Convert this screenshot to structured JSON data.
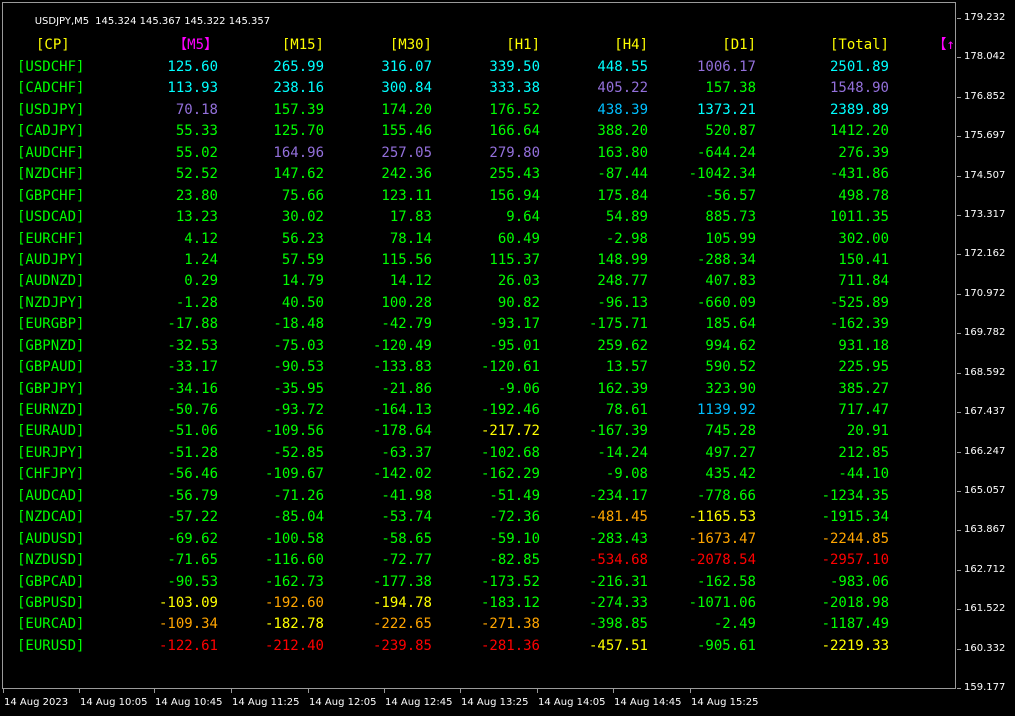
{
  "header": {
    "symbol": "USDJPY,M5",
    "quote": "145.324 145.367 145.322 145.357"
  },
  "colors": {
    "header": "#ffff00",
    "header_accent": "#ff00ff",
    "pair_label": "#00ff00",
    "green": "#00ff00",
    "light_green": "#7cfc00",
    "cyan": "#00ffff",
    "purple": "#9370db",
    "sky": "#00bfff",
    "yellow": "#ffff00",
    "orange": "#ffa500",
    "red": "#ff0000"
  },
  "table": {
    "columns": [
      {
        "label": "[CP]",
        "color": "header"
      },
      {
        "label": "【M5】",
        "color": "header_accent"
      },
      {
        "label": "[M15]",
        "color": "header"
      },
      {
        "label": "[M30]",
        "color": "header"
      },
      {
        "label": "[H1]",
        "color": "header"
      },
      {
        "label": "[H4]",
        "color": "header"
      },
      {
        "label": "[D1]",
        "color": "header"
      },
      {
        "label": "[Total]",
        "color": "header"
      },
      {
        "label": "【↑",
        "color": "header_accent"
      }
    ],
    "rows": [
      {
        "pair": "[USDCHF]",
        "cells": [
          [
            "125.60",
            "cyan"
          ],
          [
            "265.99",
            "cyan"
          ],
          [
            "316.07",
            "cyan"
          ],
          [
            "339.50",
            "cyan"
          ],
          [
            "448.55",
            "cyan"
          ],
          [
            "1006.17",
            "purple"
          ],
          [
            "2501.89",
            "cyan"
          ]
        ]
      },
      {
        "pair": "[CADCHF]",
        "cells": [
          [
            "113.93",
            "cyan"
          ],
          [
            "238.16",
            "cyan"
          ],
          [
            "300.84",
            "cyan"
          ],
          [
            "333.38",
            "cyan"
          ],
          [
            "405.22",
            "purple"
          ],
          [
            "157.38",
            "green"
          ],
          [
            "1548.90",
            "purple"
          ]
        ]
      },
      {
        "pair": "[USDJPY]",
        "cells": [
          [
            "70.18",
            "purple"
          ],
          [
            "157.39",
            "green"
          ],
          [
            "174.20",
            "green"
          ],
          [
            "176.52",
            "green"
          ],
          [
            "438.39",
            "sky"
          ],
          [
            "1373.21",
            "cyan"
          ],
          [
            "2389.89",
            "cyan"
          ]
        ]
      },
      {
        "pair": "[CADJPY]",
        "cells": [
          [
            "55.33",
            "green"
          ],
          [
            "125.70",
            "green"
          ],
          [
            "155.46",
            "green"
          ],
          [
            "166.64",
            "green"
          ],
          [
            "388.20",
            "green"
          ],
          [
            "520.87",
            "green"
          ],
          [
            "1412.20",
            "green"
          ]
        ]
      },
      {
        "pair": "[AUDCHF]",
        "cells": [
          [
            "55.02",
            "green"
          ],
          [
            "164.96",
            "purple"
          ],
          [
            "257.05",
            "purple"
          ],
          [
            "279.80",
            "purple"
          ],
          [
            "163.80",
            "green"
          ],
          [
            "-644.24",
            "green"
          ],
          [
            "276.39",
            "green"
          ]
        ]
      },
      {
        "pair": "[NZDCHF]",
        "cells": [
          [
            "52.52",
            "green"
          ],
          [
            "147.62",
            "green"
          ],
          [
            "242.36",
            "green"
          ],
          [
            "255.43",
            "green"
          ],
          [
            "-87.44",
            "green"
          ],
          [
            "-1042.34",
            "green"
          ],
          [
            "-431.86",
            "green"
          ]
        ]
      },
      {
        "pair": "[GBPCHF]",
        "cells": [
          [
            "23.80",
            "green"
          ],
          [
            "75.66",
            "green"
          ],
          [
            "123.11",
            "green"
          ],
          [
            "156.94",
            "green"
          ],
          [
            "175.84",
            "green"
          ],
          [
            "-56.57",
            "green"
          ],
          [
            "498.78",
            "green"
          ]
        ]
      },
      {
        "pair": "[USDCAD]",
        "cells": [
          [
            "13.23",
            "green"
          ],
          [
            "30.02",
            "green"
          ],
          [
            "17.83",
            "green"
          ],
          [
            "9.64",
            "green"
          ],
          [
            "54.89",
            "green"
          ],
          [
            "885.73",
            "green"
          ],
          [
            "1011.35",
            "green"
          ]
        ]
      },
      {
        "pair": "[EURCHF]",
        "cells": [
          [
            "4.12",
            "green"
          ],
          [
            "56.23",
            "green"
          ],
          [
            "78.14",
            "green"
          ],
          [
            "60.49",
            "green"
          ],
          [
            "-2.98",
            "green"
          ],
          [
            "105.99",
            "green"
          ],
          [
            "302.00",
            "green"
          ]
        ]
      },
      {
        "pair": "[AUDJPY]",
        "cells": [
          [
            "1.24",
            "green"
          ],
          [
            "57.59",
            "green"
          ],
          [
            "115.56",
            "green"
          ],
          [
            "115.37",
            "green"
          ],
          [
            "148.99",
            "green"
          ],
          [
            "-288.34",
            "green"
          ],
          [
            "150.41",
            "green"
          ]
        ]
      },
      {
        "pair": "[AUDNZD]",
        "cells": [
          [
            "0.29",
            "green"
          ],
          [
            "14.79",
            "green"
          ],
          [
            "14.12",
            "green"
          ],
          [
            "26.03",
            "green"
          ],
          [
            "248.77",
            "green"
          ],
          [
            "407.83",
            "green"
          ],
          [
            "711.84",
            "green"
          ]
        ]
      },
      {
        "pair": "[NZDJPY]",
        "cells": [
          [
            "-1.28",
            "green"
          ],
          [
            "40.50",
            "green"
          ],
          [
            "100.28",
            "green"
          ],
          [
            "90.82",
            "green"
          ],
          [
            "-96.13",
            "green"
          ],
          [
            "-660.09",
            "green"
          ],
          [
            "-525.89",
            "green"
          ]
        ]
      },
      {
        "pair": "[EURGBP]",
        "cells": [
          [
            "-17.88",
            "green"
          ],
          [
            "-18.48",
            "green"
          ],
          [
            "-42.79",
            "green"
          ],
          [
            "-93.17",
            "green"
          ],
          [
            "-175.71",
            "green"
          ],
          [
            "185.64",
            "green"
          ],
          [
            "-162.39",
            "green"
          ]
        ]
      },
      {
        "pair": "[GBPNZD]",
        "cells": [
          [
            "-32.53",
            "green"
          ],
          [
            "-75.03",
            "green"
          ],
          [
            "-120.49",
            "green"
          ],
          [
            "-95.01",
            "green"
          ],
          [
            "259.62",
            "green"
          ],
          [
            "994.62",
            "green"
          ],
          [
            "931.18",
            "green"
          ]
        ]
      },
      {
        "pair": "[GBPAUD]",
        "cells": [
          [
            "-33.17",
            "green"
          ],
          [
            "-90.53",
            "green"
          ],
          [
            "-133.83",
            "green"
          ],
          [
            "-120.61",
            "green"
          ],
          [
            "13.57",
            "green"
          ],
          [
            "590.52",
            "green"
          ],
          [
            "225.95",
            "green"
          ]
        ]
      },
      {
        "pair": "[GBPJPY]",
        "cells": [
          [
            "-34.16",
            "green"
          ],
          [
            "-35.95",
            "green"
          ],
          [
            "-21.86",
            "green"
          ],
          [
            "-9.06",
            "green"
          ],
          [
            "162.39",
            "green"
          ],
          [
            "323.90",
            "green"
          ],
          [
            "385.27",
            "green"
          ]
        ]
      },
      {
        "pair": "[EURNZD]",
        "cells": [
          [
            "-50.76",
            "green"
          ],
          [
            "-93.72",
            "green"
          ],
          [
            "-164.13",
            "green"
          ],
          [
            "-192.46",
            "green"
          ],
          [
            "78.61",
            "green"
          ],
          [
            "1139.92",
            "sky"
          ],
          [
            "717.47",
            "green"
          ]
        ]
      },
      {
        "pair": "[EURAUD]",
        "cells": [
          [
            "-51.06",
            "green"
          ],
          [
            "-109.56",
            "green"
          ],
          [
            "-178.64",
            "green"
          ],
          [
            "-217.72",
            "yellow"
          ],
          [
            "-167.39",
            "green"
          ],
          [
            "745.28",
            "green"
          ],
          [
            "20.91",
            "green"
          ]
        ]
      },
      {
        "pair": "[EURJPY]",
        "cells": [
          [
            "-51.28",
            "green"
          ],
          [
            "-52.85",
            "green"
          ],
          [
            "-63.37",
            "green"
          ],
          [
            "-102.68",
            "green"
          ],
          [
            "-14.24",
            "green"
          ],
          [
            "497.27",
            "green"
          ],
          [
            "212.85",
            "green"
          ]
        ]
      },
      {
        "pair": "[CHFJPY]",
        "cells": [
          [
            "-56.46",
            "green"
          ],
          [
            "-109.67",
            "green"
          ],
          [
            "-142.02",
            "green"
          ],
          [
            "-162.29",
            "green"
          ],
          [
            "-9.08",
            "green"
          ],
          [
            "435.42",
            "green"
          ],
          [
            "-44.10",
            "green"
          ]
        ]
      },
      {
        "pair": "[AUDCAD]",
        "cells": [
          [
            "-56.79",
            "green"
          ],
          [
            "-71.26",
            "green"
          ],
          [
            "-41.98",
            "green"
          ],
          [
            "-51.49",
            "green"
          ],
          [
            "-234.17",
            "green"
          ],
          [
            "-778.66",
            "green"
          ],
          [
            "-1234.35",
            "green"
          ]
        ]
      },
      {
        "pair": "[NZDCAD]",
        "cells": [
          [
            "-57.22",
            "green"
          ],
          [
            "-85.04",
            "green"
          ],
          [
            "-53.74",
            "green"
          ],
          [
            "-72.36",
            "green"
          ],
          [
            "-481.45",
            "orange"
          ],
          [
            "-1165.53",
            "yellow"
          ],
          [
            "-1915.34",
            "green"
          ]
        ]
      },
      {
        "pair": "[AUDUSD]",
        "cells": [
          [
            "-69.62",
            "green"
          ],
          [
            "-100.58",
            "green"
          ],
          [
            "-58.65",
            "green"
          ],
          [
            "-59.10",
            "green"
          ],
          [
            "-283.43",
            "green"
          ],
          [
            "-1673.47",
            "orange"
          ],
          [
            "-2244.85",
            "orange"
          ]
        ]
      },
      {
        "pair": "[NZDUSD]",
        "cells": [
          [
            "-71.65",
            "green"
          ],
          [
            "-116.60",
            "green"
          ],
          [
            "-72.77",
            "green"
          ],
          [
            "-82.85",
            "green"
          ],
          [
            "-534.68",
            "red"
          ],
          [
            "-2078.54",
            "red"
          ],
          [
            "-2957.10",
            "red"
          ]
        ]
      },
      {
        "pair": "[GBPCAD]",
        "cells": [
          [
            "-90.53",
            "green"
          ],
          [
            "-162.73",
            "green"
          ],
          [
            "-177.38",
            "green"
          ],
          [
            "-173.52",
            "green"
          ],
          [
            "-216.31",
            "green"
          ],
          [
            "-162.58",
            "green"
          ],
          [
            "-983.06",
            "green"
          ]
        ]
      },
      {
        "pair": "[GBPUSD]",
        "cells": [
          [
            "-103.09",
            "yellow"
          ],
          [
            "-192.60",
            "orange"
          ],
          [
            "-194.78",
            "yellow"
          ],
          [
            "-183.12",
            "green"
          ],
          [
            "-274.33",
            "green"
          ],
          [
            "-1071.06",
            "green"
          ],
          [
            "-2018.98",
            "green"
          ]
        ]
      },
      {
        "pair": "[EURCAD]",
        "cells": [
          [
            "-109.34",
            "orange"
          ],
          [
            "-182.78",
            "yellow"
          ],
          [
            "-222.65",
            "orange"
          ],
          [
            "-271.38",
            "orange"
          ],
          [
            "-398.85",
            "green"
          ],
          [
            "-2.49",
            "green"
          ],
          [
            "-1187.49",
            "green"
          ]
        ]
      },
      {
        "pair": "[EURUSD]",
        "cells": [
          [
            "-122.61",
            "red"
          ],
          [
            "-212.40",
            "red"
          ],
          [
            "-239.85",
            "red"
          ],
          [
            "-281.36",
            "red"
          ],
          [
            "-457.51",
            "yellow"
          ],
          [
            "-905.61",
            "green"
          ],
          [
            "-2219.33",
            "yellow"
          ]
        ]
      }
    ]
  },
  "y_axis": {
    "labels": [
      "179.232",
      "178.042",
      "176.852",
      "175.697",
      "174.507",
      "173.317",
      "172.162",
      "170.972",
      "169.782",
      "168.592",
      "167.437",
      "166.247",
      "165.057",
      "163.867",
      "162.712",
      "161.522",
      "160.332",
      "159.177"
    ]
  },
  "x_axis": {
    "labels": [
      "14 Aug 2023",
      "14 Aug 10:05",
      "14 Aug 10:45",
      "14 Aug 11:25",
      "14 Aug 12:05",
      "14 Aug 12:45",
      "14 Aug 13:25",
      "14 Aug 14:05",
      "14 Aug 14:45",
      "14 Aug 15:25"
    ]
  }
}
